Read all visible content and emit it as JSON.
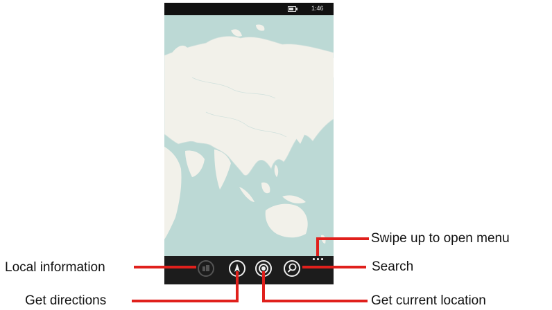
{
  "status_bar": {
    "time": "1:46",
    "battery_icon": "battery-icon"
  },
  "map": {
    "land_color": "#f2f1ea",
    "water_color": "#bcd9d5"
  },
  "app_bar": {
    "buttons": [
      {
        "name": "local-information-button",
        "icon": "local-info-icon",
        "enabled": false
      },
      {
        "name": "get-directions-button",
        "icon": "compass-arrow-icon",
        "enabled": true
      },
      {
        "name": "get-current-location-button",
        "icon": "location-dot-icon",
        "enabled": true
      },
      {
        "name": "search-button",
        "icon": "search-icon",
        "enabled": true
      }
    ],
    "more_icon": "ellipsis-icon"
  },
  "callouts": {
    "swipe_up": "Swipe up to open menu",
    "search": "Search",
    "local_information": "Local information",
    "get_directions": "Get directions",
    "get_current_location": "Get current location"
  },
  "accent_color": "#e0201c"
}
